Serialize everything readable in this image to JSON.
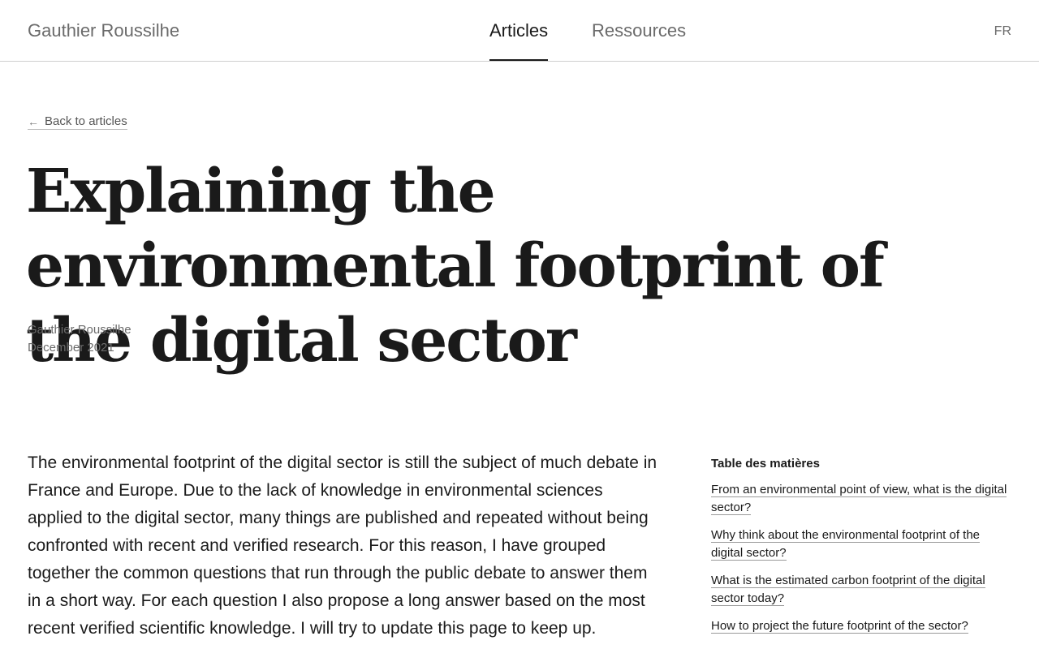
{
  "header": {
    "site_name": "Gauthier Roussilhe",
    "nav": [
      {
        "label": "Articles",
        "active": true
      },
      {
        "label": "Ressources",
        "active": false
      }
    ],
    "lang": "FR"
  },
  "article": {
    "back_label": "Back to articles",
    "title": "Explaining the environmental footprint of the digital sector",
    "author": "Gauthier Roussilhe",
    "date": "December 2021",
    "intro": "The environmental footprint of the digital sector is still the subject of much debate in France and Europe. Due to the lack of knowledge in environmental sciences applied to the digital sector, many things are published and repeated without being confronted with recent and verified research. For this reason, I have grouped together the common questions that run through the public debate to answer them in a short way. For each question I also propose a long answer based on the most recent verified scientific knowledge. I will try to update this page to keep up."
  },
  "toc": {
    "title": "Table des matières",
    "items": [
      "From an environmental point of view, what is the digital sector?",
      "Why think about the environmental footprint of the digital sector?",
      "What is the estimated carbon footprint of the digital sector today?",
      "How to project the future footprint of the sector?"
    ]
  }
}
